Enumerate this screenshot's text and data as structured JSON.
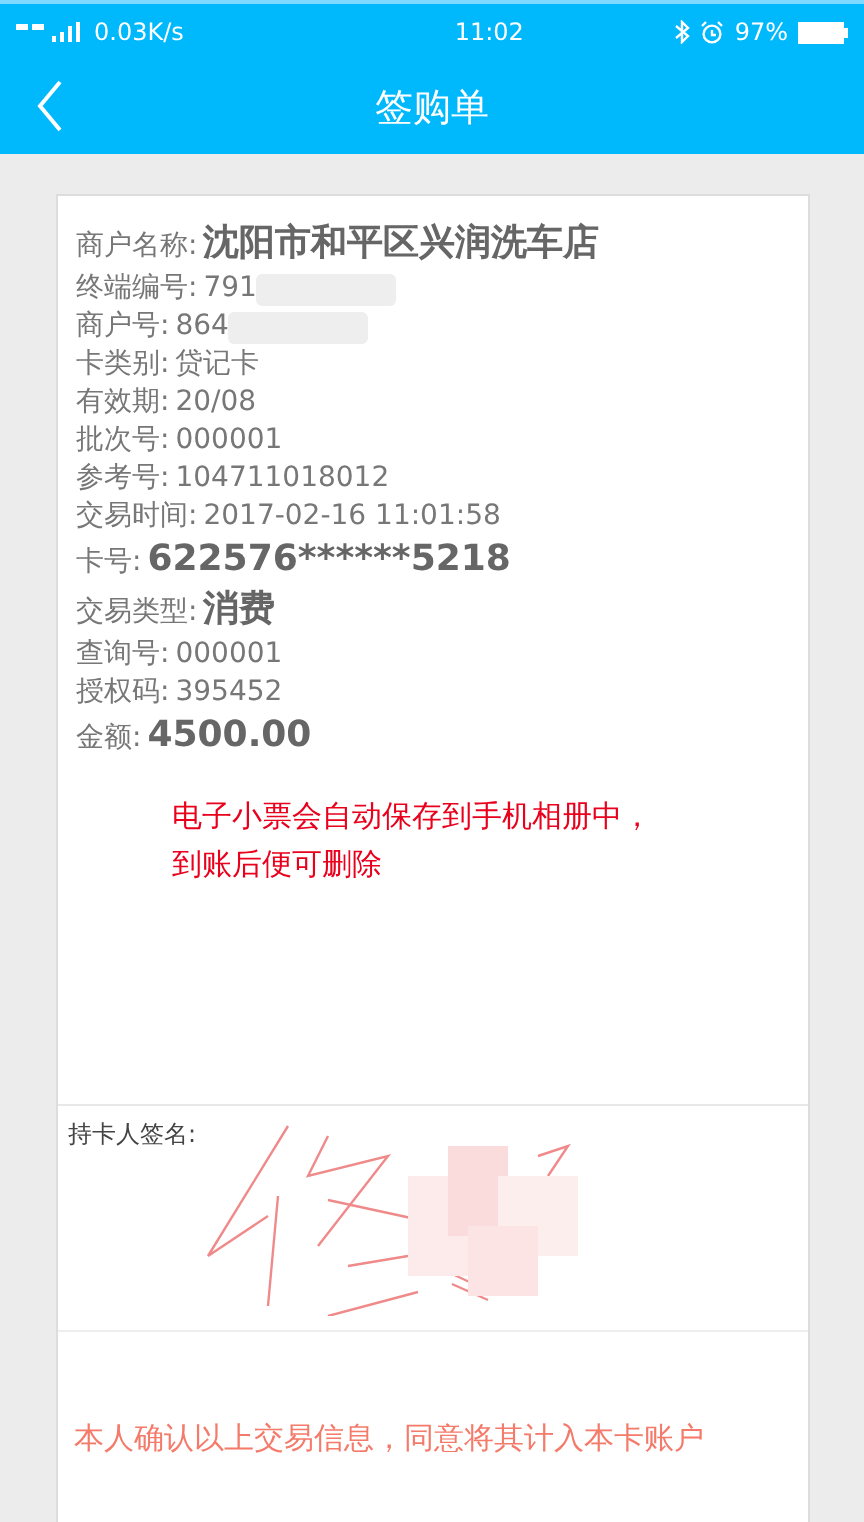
{
  "status_bar": {
    "network": "0.03K/s",
    "time": "11:02",
    "battery": "97%"
  },
  "header": {
    "title": "签购单"
  },
  "receipt": {
    "fields": [
      {
        "label": "商户名称:",
        "value": "沈阳市和平区兴润洗车店",
        "kind": "bold",
        "redacted": false
      },
      {
        "label": "终端编号:",
        "value": "791",
        "kind": "plain",
        "redacted": true
      },
      {
        "label": "商户号:",
        "value": "864",
        "kind": "plain",
        "redacted": true
      },
      {
        "label": "卡类别:",
        "value": "贷记卡",
        "kind": "plain",
        "redacted": false
      },
      {
        "label": "有效期:",
        "value": "20/08",
        "kind": "plain",
        "redacted": false
      },
      {
        "label": "批次号:",
        "value": "000001",
        "kind": "plain",
        "redacted": false
      },
      {
        "label": "参考号:",
        "value": "104711018012",
        "kind": "plain",
        "redacted": false
      },
      {
        "label": "交易时间:",
        "value": "2017-02-16 11:01:58",
        "kind": "plain",
        "redacted": false
      },
      {
        "label": "卡号:",
        "value": "622576******5218",
        "kind": "bold",
        "redacted": false
      },
      {
        "label": "交易类型:",
        "value": "消费",
        "kind": "bold",
        "redacted": false
      },
      {
        "label": "查询号:",
        "value": "000001",
        "kind": "plain",
        "redacted": false
      },
      {
        "label": "授权码:",
        "value": "395452",
        "kind": "plain",
        "redacted": false
      },
      {
        "label": "金额:",
        "value": "4500.00",
        "kind": "bold",
        "redacted": false
      }
    ],
    "note": "电子小票会自动保存到手机相册中，到账后便可删除",
    "signature_label": "持卡人签名:",
    "confirmation": "本人确认以上交易信息，同意将其计入本卡账户"
  }
}
